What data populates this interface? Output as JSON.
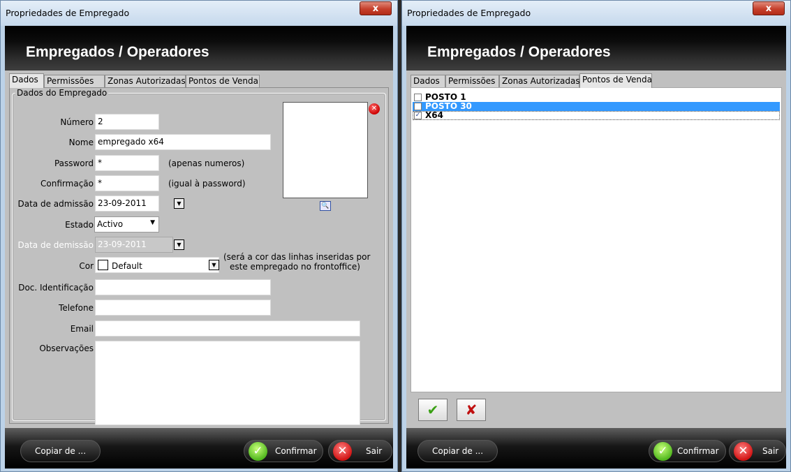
{
  "left": {
    "window_title": "Propriedades de Empregado",
    "close": "x",
    "header_title": "Empregados / Operadores",
    "tabs": [
      "Dados",
      "Permissões",
      "Zonas Autorizadas",
      "Pontos de Venda"
    ],
    "group_title": "Dados do Empregado",
    "fields": {
      "numero_label": "Número",
      "numero_value": "2",
      "nome_label": "Nome",
      "nome_value": "empregado x64",
      "password_label": "Password",
      "password_value": "*",
      "password_hint": "(apenas numeros)",
      "confirmacao_label": "Confirmação",
      "confirmacao_value": "*",
      "confirmacao_hint": "(igual à password)",
      "admissao_label": "Data de admissão",
      "admissao_value": "23-09-2011",
      "estado_label": "Estado",
      "estado_value": "Activo",
      "demissao_label": "Data de demissão",
      "demissao_value": "23-09-2011",
      "cor_label": "Cor",
      "cor_value": "Default",
      "cor_hint_1": "(será a cor das linhas inseridas por",
      "cor_hint_2": "este empregado no frontoffice)",
      "doc_label": "Doc. Identificação",
      "doc_value": "",
      "telefone_label": "Telefone",
      "telefone_value": "",
      "email_label": "Email",
      "email_value": "",
      "obs_label": "Observações",
      "obs_value": ""
    },
    "footer": {
      "copy_label": "Copiar de ...",
      "confirm_label": "Confirmar",
      "exit_label": "Sair"
    }
  },
  "right": {
    "window_title": "Propriedades de Empregado",
    "close": "x",
    "header_title": "Empregados / Operadores",
    "tabs": [
      "Dados",
      "Permissões",
      "Zonas Autorizadas",
      "Pontos de Venda"
    ],
    "list": [
      {
        "label": "POSTO 1",
        "checked": false,
        "selected": false
      },
      {
        "label": "POSTO 30",
        "checked": false,
        "selected": true
      },
      {
        "label": "X64",
        "checked": true,
        "selected": false
      }
    ],
    "footer": {
      "copy_label": "Copiar de ...",
      "confirm_label": "Confirmar",
      "exit_label": "Sair"
    }
  }
}
